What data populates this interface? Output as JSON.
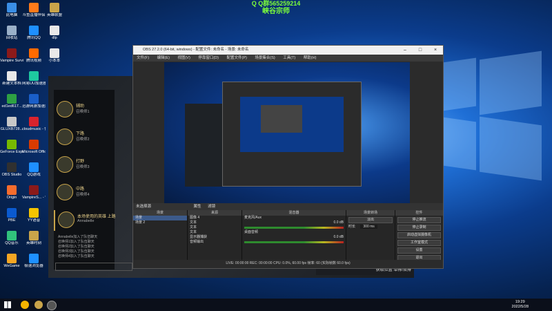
{
  "overlay": {
    "qq": "Q Q群565259214",
    "name": "峡谷宗师"
  },
  "desktop_icons": [
    {
      "label": "此电脑",
      "color": "#3a8ee6"
    },
    {
      "label": "斗鱼直播伴侣",
      "color": "#ff7a1a"
    },
    {
      "label": "英雄联盟",
      "color": "#c9a44a"
    },
    {
      "label": "回收站",
      "color": "#9ab0c8"
    },
    {
      "label": "腾讯QQ",
      "color": "#1e90ff"
    },
    {
      "label": "dlp",
      "color": "#e8e8e8"
    },
    {
      "label": "Vampire Surviv...",
      "color": "#8b1a1a"
    },
    {
      "label": "腾讯视频",
      "color": "#ff6a00"
    },
    {
      "label": "小本本",
      "color": "#e8e8e8"
    },
    {
      "label": "新建文本档",
      "color": "#e8e8e8"
    },
    {
      "label": "网易UU加速器",
      "color": "#1ec8a0"
    },
    {
      "label": "ed1ed617...",
      "color": "#2ea043"
    },
    {
      "label": "迅游网游加速器",
      "color": "#1a5ec8"
    },
    {
      "label": "GLUXB728...",
      "color": "#c8c8c8"
    },
    {
      "label": "cloudmusic - 快捷方式",
      "color": "#d9232d"
    },
    {
      "label": "GeForce Experience",
      "color": "#76b900"
    },
    {
      "label": "Microsoft Office",
      "color": "#d83b01"
    },
    {
      "label": "OBS Studio",
      "color": "#303030"
    },
    {
      "label": "QQ游戏",
      "color": "#1e90ff"
    },
    {
      "label": "Origin",
      "color": "#f56c2d"
    },
    {
      "label": "VampireS... - 快捷方式",
      "color": "#8b1a1a"
    },
    {
      "label": "PBE",
      "color": "#0a5ad0"
    },
    {
      "label": "YY语音",
      "color": "#f5c400"
    },
    {
      "label": "QQ音乐",
      "color": "#31c27c"
    },
    {
      "label": "英雄时刻",
      "color": "#c9a44a"
    },
    {
      "label": "WeGame",
      "color": "#f5a623"
    },
    {
      "label": "极速浏览器",
      "color": "#1e90ff"
    }
  ],
  "launcher": {
    "champions": [
      {
        "name": "辅助",
        "sub": "召唤师1"
      },
      {
        "name": "下路",
        "sub": "召唤师2"
      },
      {
        "name": "打野",
        "sub": "召唤师3"
      },
      {
        "name": "中路",
        "sub": "召唤师4"
      },
      {
        "name": "本场使用的英雄 上路",
        "sub": "Annabelle"
      }
    ],
    "chat": [
      "Annabelle加入了队伍聊天",
      "召唤师1加入了队伍聊天",
      "召唤师2加入了队伍聊天",
      "召唤师3加入了队伍聊天",
      "召唤师4加入了队伍聊天"
    ],
    "footer": "获取位置 单排/双排"
  },
  "obs": {
    "title": "OBS 27.2.0 (64-bit, windows) - 配置文件: 未命名 - 场景: 未命名",
    "menu": [
      "文件(F)",
      "编辑(E)",
      "视图(V)",
      "停靠窗口(D)",
      "配置文件(P)",
      "场景集合(S)",
      "工具(T)",
      "帮助(H)"
    ],
    "source_bar": [
      "未选择源",
      "属性",
      "滤镜"
    ],
    "panels": {
      "scenes": {
        "title": "场景",
        "items": [
          "场景",
          "场景 2"
        ]
      },
      "sources": {
        "title": "来源",
        "items": [
          "图像 4",
          "文本",
          "文本",
          "文本",
          "显示器捕获",
          "音频输出"
        ]
      },
      "mixer": {
        "title": "混音器",
        "tracks": [
          {
            "name": "麦克风/Aux",
            "db": "0.0 dB"
          },
          {
            "name": "桌面音频",
            "db": "0.0 dB"
          }
        ]
      },
      "transitions": {
        "title": "场景转场",
        "type": "淡出",
        "duration_label": "时长",
        "duration": "300 ms"
      },
      "controls": {
        "title": "控件",
        "buttons": [
          "停止推流",
          "停止录制",
          "启动虚拟摄像机",
          "工作室模式",
          "设置",
          "退出"
        ]
      }
    },
    "statusbar": "LIVE: 00:00:00   REC: 00:00:00   CPU: 0.0%, 60.00 fps   帧率: 60  (实际帧数 60.0 fps)"
  },
  "taskbar": {
    "time": "19:29",
    "date": "2022/5/28"
  }
}
